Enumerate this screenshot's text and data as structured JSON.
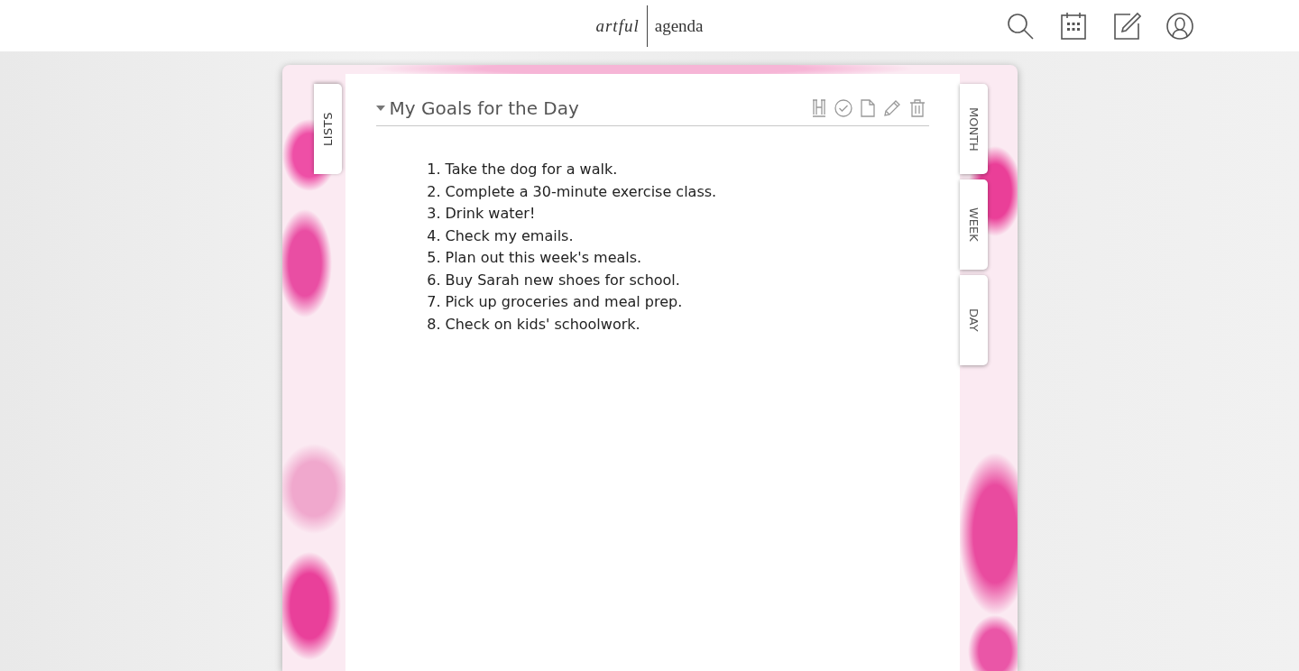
{
  "header": {
    "logo": {
      "first": "artful",
      "second": "agenda"
    }
  },
  "left_tabs": [
    {
      "label": "LISTS",
      "selected": true
    }
  ],
  "right_tabs": [
    {
      "label": "MONTH",
      "selected": false
    },
    {
      "label": "WEEK",
      "selected": false
    },
    {
      "label": "DAY",
      "selected": false
    }
  ],
  "list": {
    "title": "My Goals for the Day",
    "expanded": true,
    "items": [
      {
        "number": "1.",
        "text": "Take the dog for a walk."
      },
      {
        "number": "2.",
        "text": "Complete a 30-minute exercise class."
      },
      {
        "number": "3.",
        "text": "Drink water!"
      },
      {
        "number": "4.",
        "text": "Check my emails."
      },
      {
        "number": "5.",
        "text": "Plan out this week's meals."
      },
      {
        "number": "6.",
        "text": "Buy Sarah new shoes for school."
      },
      {
        "number": "7.",
        "text": "Pick up groceries and meal prep."
      },
      {
        "number": "8.",
        "text": "Check on kids' schoolwork."
      }
    ]
  }
}
